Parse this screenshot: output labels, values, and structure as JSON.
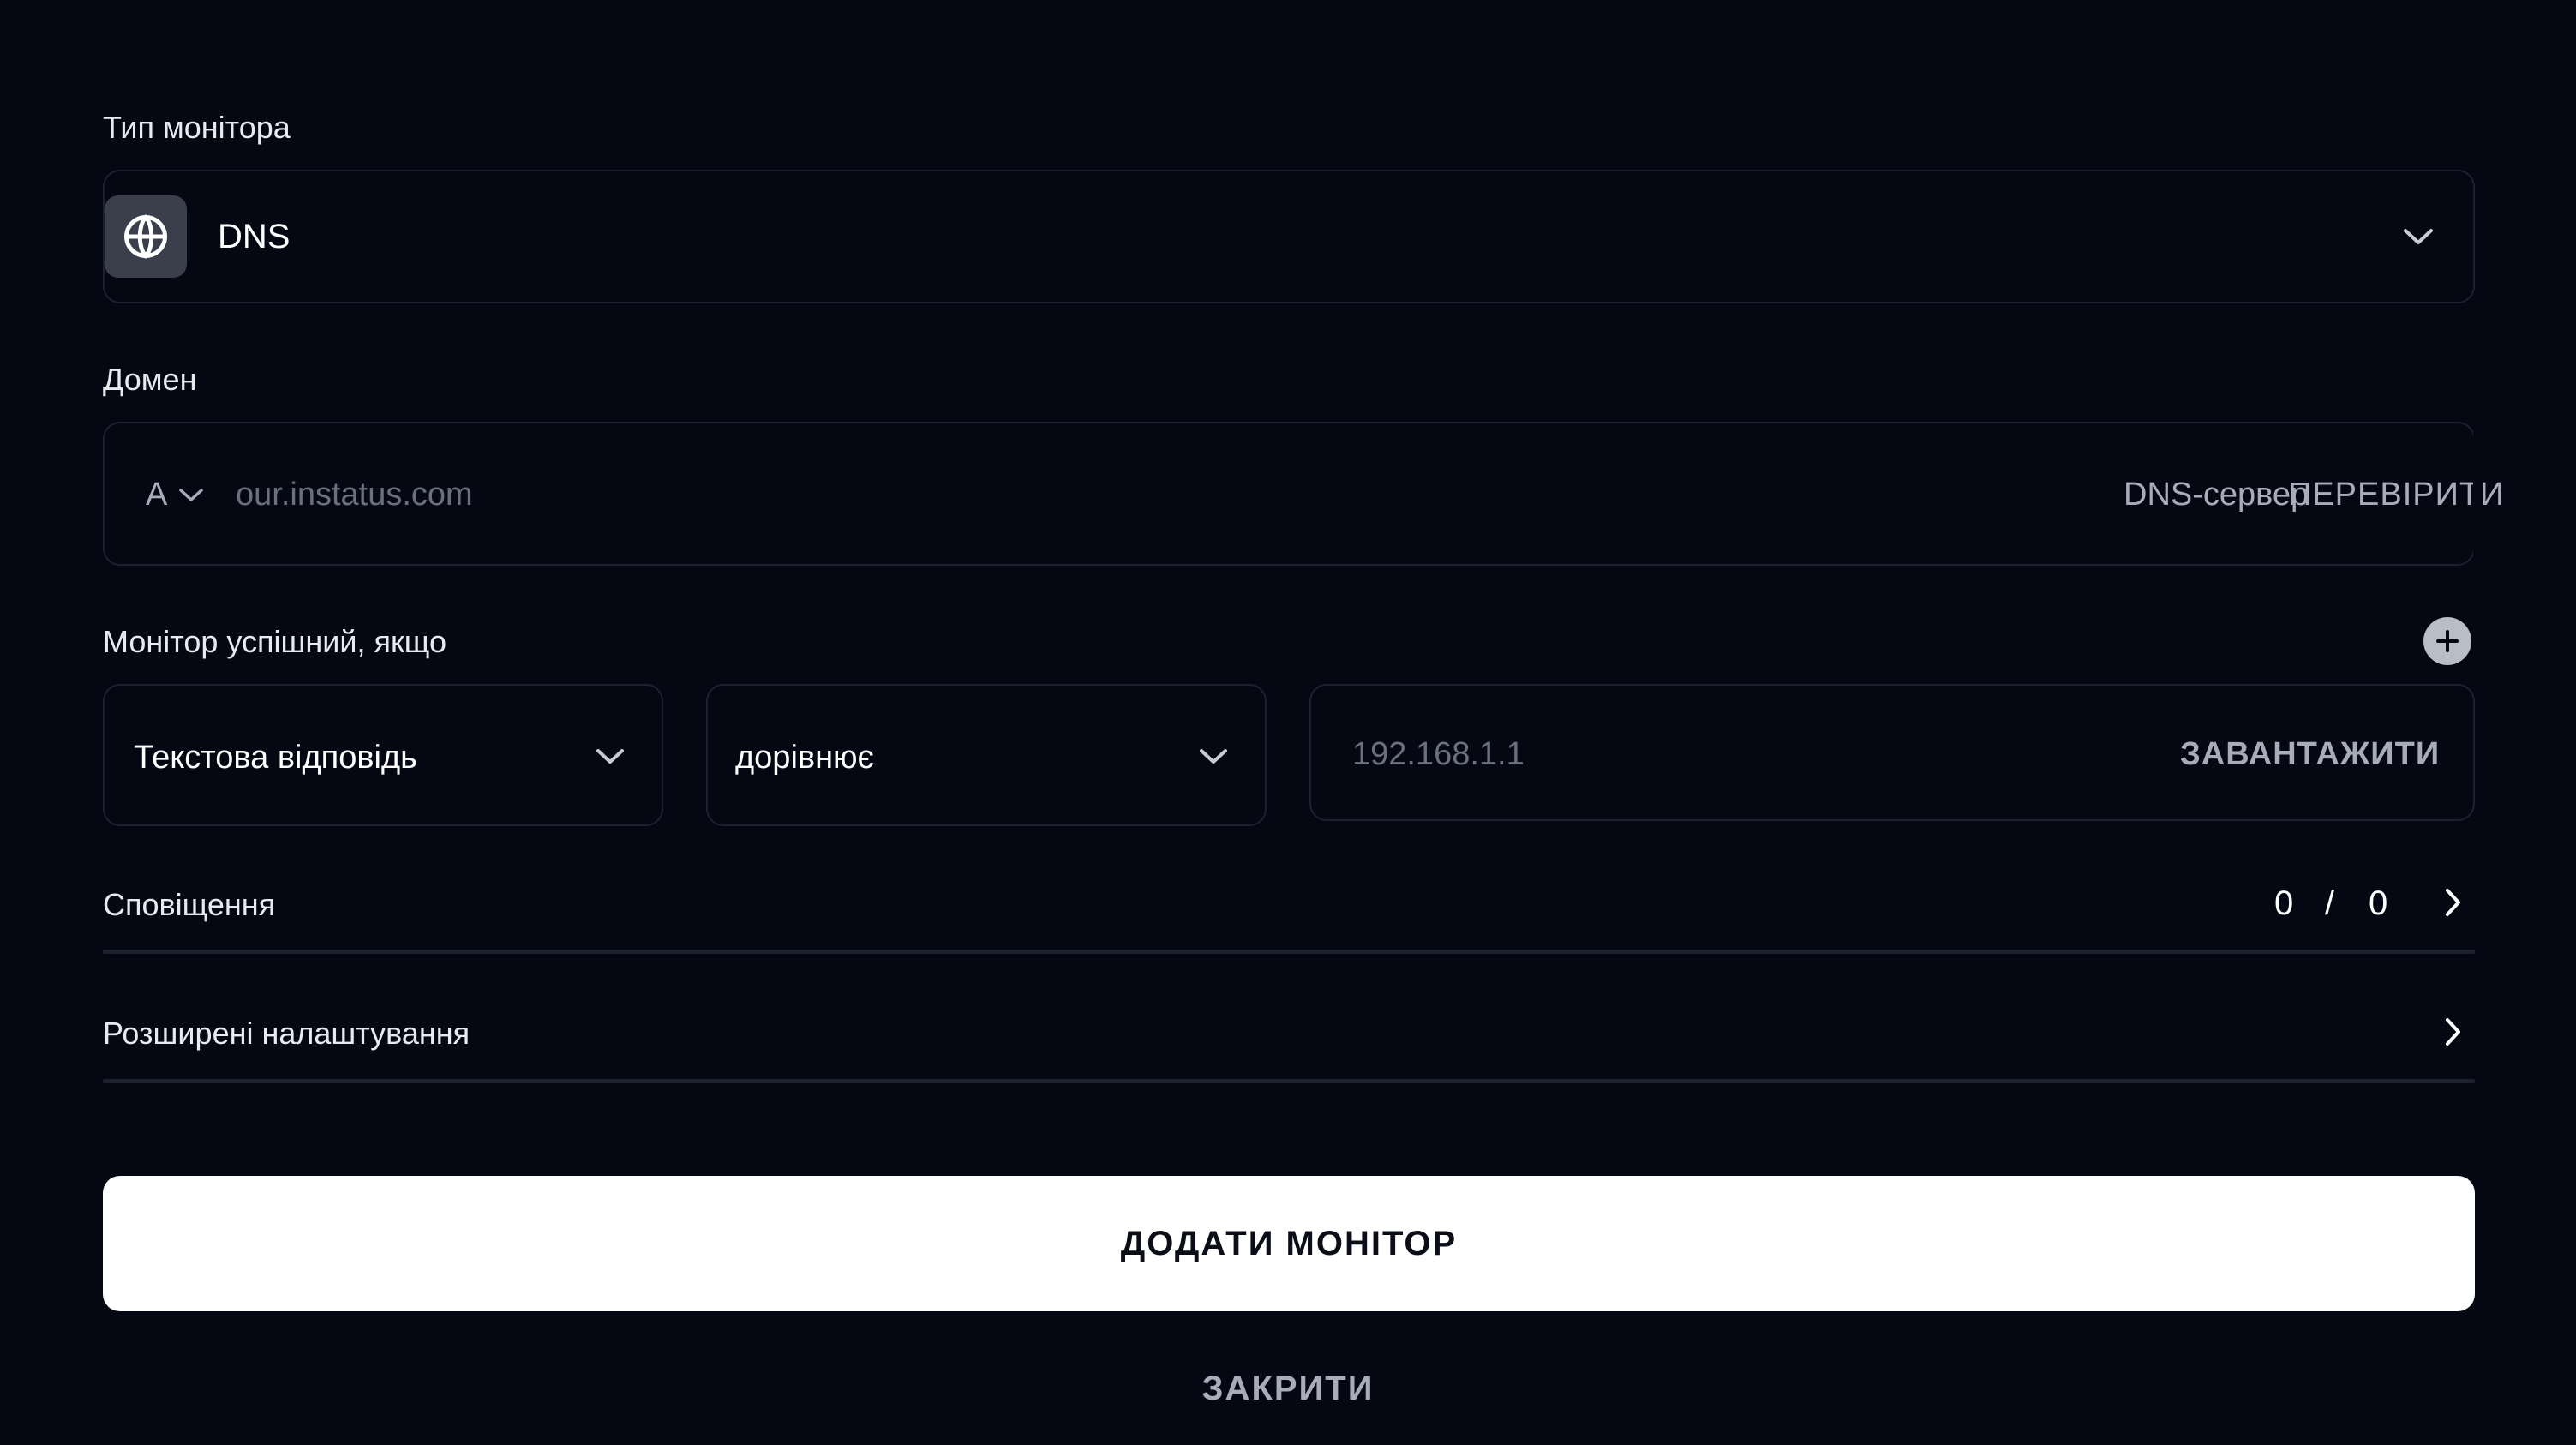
{
  "form": {
    "monitor_type": {
      "label": "Тип монітора",
      "value": "DNS",
      "icon": "globe-icon"
    },
    "domain": {
      "label": "Домен",
      "record_type": "A",
      "placeholder": "our.instatus.com",
      "dns_server_label": "DNS-сервер",
      "verify_label": "ПЕРЕВІРИТИ"
    },
    "conditions": {
      "label": "Монітор успішний, якщо",
      "field": "Текстова відповідь",
      "operator": "дорівнює",
      "value_placeholder": "192.168.1.1",
      "load_label": "ЗАВАНТАЖИТИ"
    },
    "notifications": {
      "label": "Сповіщення",
      "selected": "0",
      "separator": "/",
      "total": "0"
    },
    "advanced": {
      "label": "Розширені налаштування"
    }
  },
  "actions": {
    "primary_label": "ДОДАТИ МОНІТОР",
    "close_label": "ЗАКРИТИ"
  },
  "colors": {
    "background": "#050813",
    "border": "#1c2130",
    "primary_button": "#ffffff"
  }
}
